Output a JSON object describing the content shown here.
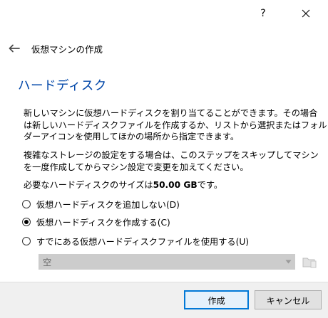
{
  "titlebar": {
    "help_label": "?",
    "close_label": "✕"
  },
  "header": {
    "title": "仮想マシンの作成"
  },
  "page": {
    "heading": "ハードディスク"
  },
  "description": {
    "p1_line1": "新しいマシンに仮想ハードディスクを割り当てることができます。その場合",
    "p1_line2": "は新しいハードディスクファイルを作成するか、リストから選択またはフォル",
    "p1_line3": "ダーアイコンを使用してほかの場所から指定できます。",
    "p2_line1": "複雑なストレージの設定をする場合は、このステップをスキップしてマシン",
    "p2_line2": "を一度作成してからマシン設定で変更を加えてください。",
    "p3_prefix": "必要なハードディスクのサイズは",
    "p3_size": "50.00 GB",
    "p3_suffix": "です。"
  },
  "options": {
    "no_disk": "仮想ハードディスクを追加しない(D)",
    "create_disk": "仮想ハードディスクを作成する(C)",
    "existing_disk": "すでにある仮想ハードディスクファイルを使用する(U)",
    "selected": "create_disk"
  },
  "existing_file_combo": {
    "value": "空"
  },
  "buttons": {
    "create": "作成",
    "cancel": "キャンセル"
  },
  "colors": {
    "heading": "#0046a8",
    "default_button_border": "#0078d7",
    "footer_bg": "#f0f0f0",
    "disabled_combo_bg": "#cccccc"
  }
}
